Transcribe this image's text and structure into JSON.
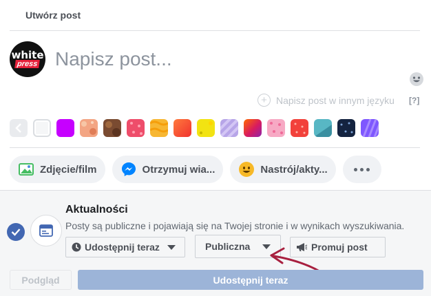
{
  "composer": {
    "title": "Utwórz post",
    "placeholder": "Napisz post...",
    "other_language_label": "Napisz post w innym języku",
    "help_label": "[?]"
  },
  "avatar": {
    "logo_top": "white",
    "logo_bottom": "press"
  },
  "backgrounds": {
    "back_icon": "chevron-left-icon",
    "swatches": [
      {
        "name": "white",
        "color": "#f5f6f7"
      },
      {
        "name": "purple",
        "color": "#c600ff"
      },
      {
        "name": "peach-pattern",
        "color": "#f3a583"
      },
      {
        "name": "brown-pattern",
        "color": "#8b5a3c"
      },
      {
        "name": "red-pattern",
        "color": "#f0506e"
      },
      {
        "name": "orange-pattern",
        "color": "#f7b733"
      },
      {
        "name": "red-orange",
        "color": "#fc4a1a"
      },
      {
        "name": "yellow-pattern",
        "color": "#f5e60d"
      },
      {
        "name": "lavender-pattern",
        "color": "#b39ddb"
      },
      {
        "name": "pink-magenta",
        "color": "#d81b60"
      },
      {
        "name": "pink-dots",
        "color": "#f8a5c2"
      },
      {
        "name": "red-dots",
        "color": "#f44336"
      },
      {
        "name": "teal-pattern",
        "color": "#4fb3bf"
      },
      {
        "name": "navy-pattern",
        "color": "#1a2a4a"
      },
      {
        "name": "violet-stripes",
        "color": "#7c4dff"
      }
    ]
  },
  "actions": [
    {
      "label": "Zdjęcie/film",
      "icon": "photo-icon"
    },
    {
      "label": "Otrzymuj wia...",
      "icon": "messenger-icon"
    },
    {
      "label": "Nastrój/akty...",
      "icon": "smiley-icon"
    }
  ],
  "audience": {
    "feed_title": "Aktualności",
    "feed_description": "Posty są publiczne i pojawiają się na Twojej stronie i w wynikach wyszukiwania.",
    "share_now_dropdown": "Udostępnij teraz",
    "privacy_dropdown": "Publiczna",
    "promote_label": "Promuj post"
  },
  "footer": {
    "preview_label": "Podgląd",
    "share_label": "Udostępnij teraz"
  },
  "colors": {
    "accent": "#4267b2",
    "share_disabled": "#9cb4d8",
    "annotation_arrow": "#a8203f"
  }
}
